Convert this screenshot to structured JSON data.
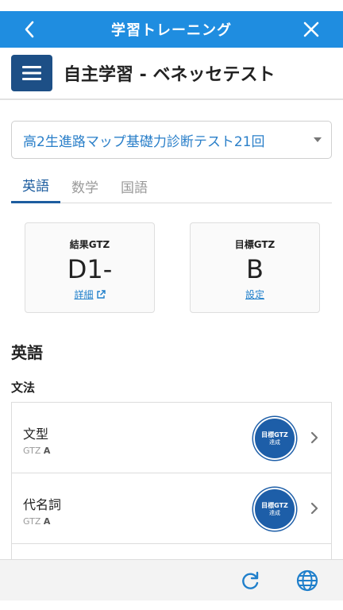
{
  "topbar": {
    "title": "学習トレーニング"
  },
  "header": {
    "title": "自主学習 - ベネッセテスト"
  },
  "test_select": {
    "value": "高2生進路マップ基礎力診断テスト21回"
  },
  "tabs": [
    {
      "label": "英語"
    },
    {
      "label": "数学"
    },
    {
      "label": "国語"
    }
  ],
  "result_card": {
    "label": "結果GTZ",
    "value": "D1-",
    "link": "詳細"
  },
  "target_card": {
    "label": "目標GTZ",
    "value": "B",
    "link": "設定"
  },
  "section": {
    "title": "英語",
    "subtitle": "文法"
  },
  "items": [
    {
      "name": "文型",
      "gtz_label": "GTZ",
      "gtz_value": "A",
      "badge_line1": "目標GTZ",
      "badge_line2": "達成"
    },
    {
      "name": "代名詞",
      "gtz_label": "GTZ",
      "gtz_value": "A",
      "badge_line1": "目標GTZ",
      "badge_line2": "達成"
    }
  ],
  "colors": {
    "primary": "#1f8de0",
    "navy": "#1d4f86",
    "link": "#1f7fcb"
  }
}
